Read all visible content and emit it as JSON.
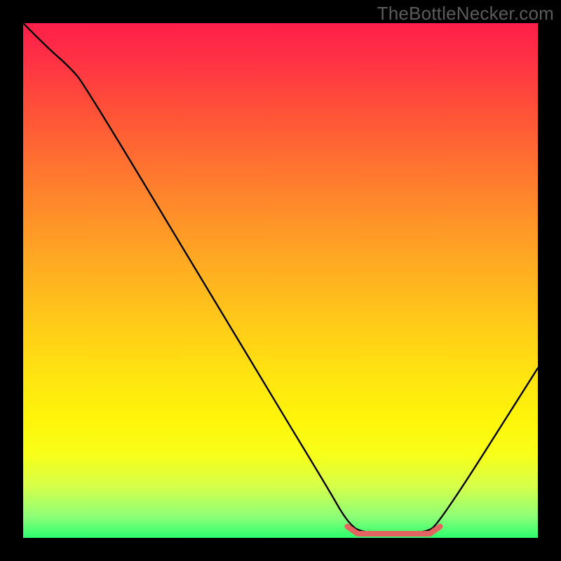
{
  "watermark": "TheBottleNecker.com",
  "chart_data": {
    "type": "line",
    "title": "",
    "xlabel": "",
    "ylabel": "",
    "xlim": [
      0,
      100
    ],
    "ylim": [
      0,
      100
    ],
    "note": "No axis ticks or numeric labels are rendered in the image; curve values are normalized 0–100 estimates read from the plot. Higher y = higher bottleneck. The red flat segment at the bottom marks the optimal (near-zero bottleneck) range.",
    "series": [
      {
        "name": "bottleneck-curve",
        "color": "#000000",
        "points": [
          {
            "x": 0.0,
            "y": 100.0
          },
          {
            "x": 5.0,
            "y": 95.0
          },
          {
            "x": 9.0,
            "y": 91.5
          },
          {
            "x": 12.0,
            "y": 88.0
          },
          {
            "x": 45.0,
            "y": 33.0
          },
          {
            "x": 59.0,
            "y": 10.0
          },
          {
            "x": 63.0,
            "y": 3.0
          },
          {
            "x": 66.0,
            "y": 0.8
          },
          {
            "x": 78.0,
            "y": 0.8
          },
          {
            "x": 81.0,
            "y": 3.0
          },
          {
            "x": 100.0,
            "y": 33.0
          }
        ]
      },
      {
        "name": "optimal-range-marker",
        "color": "#e2635f",
        "points": [
          {
            "x": 63.0,
            "y": 2.2
          },
          {
            "x": 65.0,
            "y": 0.8
          },
          {
            "x": 79.0,
            "y": 0.8
          },
          {
            "x": 81.0,
            "y": 2.2
          }
        ]
      }
    ],
    "gradient_stops": [
      {
        "pct": 0,
        "color": "#ff1f49"
      },
      {
        "pct": 6,
        "color": "#ff2e46"
      },
      {
        "pct": 17,
        "color": "#ff5138"
      },
      {
        "pct": 30,
        "color": "#ff7a2e"
      },
      {
        "pct": 44,
        "color": "#ffa324"
      },
      {
        "pct": 57,
        "color": "#ffc71a"
      },
      {
        "pct": 68,
        "color": "#ffe311"
      },
      {
        "pct": 77,
        "color": "#fff50a"
      },
      {
        "pct": 84,
        "color": "#f7ff1a"
      },
      {
        "pct": 90,
        "color": "#d6ff4a"
      },
      {
        "pct": 96,
        "color": "#8bff78"
      },
      {
        "pct": 100,
        "color": "#2bff6e"
      }
    ]
  }
}
